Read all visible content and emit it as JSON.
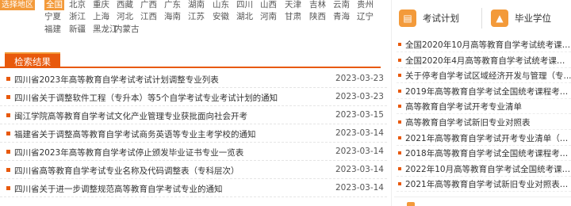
{
  "region": {
    "label": "选择地区",
    "provinces": [
      "全国",
      "北京",
      "重庆",
      "西藏",
      "广西",
      "广东",
      "湖南",
      "山东",
      "四川",
      "山西",
      "天津",
      "吉林",
      "云南",
      "贵州",
      "宁夏",
      "浙江",
      "上海",
      "河北",
      "江西",
      "海南",
      "江苏",
      "安徽",
      "湖北",
      "河南",
      "甘肃",
      "陕西",
      "青海",
      "辽宁",
      "福建",
      "新疆",
      "黑龙江",
      "内蒙古"
    ],
    "active": "全国"
  },
  "results_tab": "检索结果",
  "results": [
    {
      "title": "四川省2023年高等教育自学考试考试计划调整专业列表",
      "date": "2023-03-23"
    },
    {
      "title": "四川省关于调整软件工程（专升本）等5个自学考试专业考试计划的通知",
      "date": "2023-03-23"
    },
    {
      "title": "闽江学院高等教育自学考试文化产业管理专业获批面向社会开考",
      "date": "2023-03-15"
    },
    {
      "title": "福建省关于调整高等教育自学考试商务英语等专业主考学校的通知",
      "date": "2023-03-14"
    },
    {
      "title": "四川省2023年高等教育自学考试停止颁发毕业证书专业一览表",
      "date": "2023-03-14"
    },
    {
      "title": "四川省高等教育自学考试专业名称及代码调整表（专科层次）",
      "date": "2023-03-14"
    },
    {
      "title": "四川省关于进一步调整规范高等教育自学考试专业的通知",
      "date": "2023-03-14"
    }
  ],
  "side": {
    "tabs": [
      {
        "label": "考试计划",
        "icon": "document-icon"
      },
      {
        "label": "毕业学位",
        "icon": "graduation-cap-icon"
      }
    ],
    "items": [
      "全国2020年10月高等教育自学考试统考课程...",
      "全国2020年4月高等教育自学考试统考课程...",
      "关于停考自学考试区域经济开发与管理（专...",
      "2019年高等教育自学考试全国统考课程考试...",
      "高等教育自学考试开考专业清单",
      "高等教育自学考试新旧专业对照表",
      "2021年高等教育自学考试开考专业清单（普...",
      "2018年高等教育自学考试全国统考课程考试...",
      "2022年10月高等教育自学考试全国统考课程...",
      "2021年高等教育自学考试新旧专业对照表（..."
    ]
  },
  "colors": {
    "accent": "#e8590c",
    "accent_light": "#f39a3a"
  }
}
